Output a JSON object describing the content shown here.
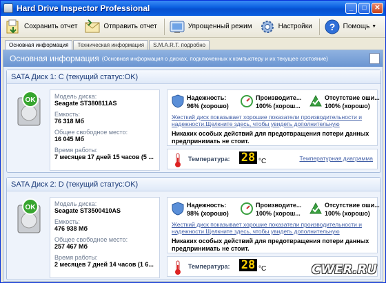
{
  "window": {
    "title": "Hard Drive Inspector Professional"
  },
  "toolbar": {
    "send_report": "Сохранить отчет",
    "email_report": "Отправить отчет",
    "simple_mode": "Упрощенный режим",
    "settings": "Настройки",
    "help": "Помощь"
  },
  "tabs": [
    "Основная информация",
    "Техническая информация",
    "S.M.A.R.T. подробно"
  ],
  "main": {
    "title": "Основная информация",
    "subtitle": "(Основная информация о дисках, подключенных к компьютеру и их текущее состояние)"
  },
  "labels": {
    "model": "Модель диска:",
    "capacity": "Емкость:",
    "free": "Общее свободное место:",
    "uptime": "Время работы:",
    "reliability": "Надежность:",
    "performance": "Производите...",
    "no_errors": "Отсутствие оши...",
    "warn_link": "Жесткий диск показывает хорошие показатели производительности и надежности.Щелкните здесь, чтобы увидеть дополнительную информацию о",
    "advice": "Никаких особых действий для предотвращения потери данных предпринимать не стоит.",
    "temperature": "Температура:",
    "temp_unit": "°C",
    "temp_chart": "Температурная диаграмма",
    "ok": "OK"
  },
  "disks": [
    {
      "header": "SATA Диск 1: C (текущий статус:OK)",
      "model": "Seagate ST380811AS",
      "capacity": "76 318 Мб",
      "free": "16 045 Мб",
      "uptime": "7 месяцев 17 дней 15 часов (5 ...",
      "reliability": "96% (хорошо)",
      "performance": "100% (хорош...",
      "no_errors": "100% (хорошо)",
      "temperature": "28"
    },
    {
      "header": "SATA Диск 2: D (текущий статус:OK)",
      "model": "Seagate ST3500410AS",
      "capacity": "476 938 Мб",
      "free": "257 467 Мб",
      "uptime": "2 месяцев 7 дней 14 часов (1 6...",
      "reliability": "98% (хорошо)",
      "performance": "100% (хорош...",
      "no_errors": "100% (хорошо)",
      "temperature": "28"
    }
  ],
  "watermark": "CWER.RU"
}
